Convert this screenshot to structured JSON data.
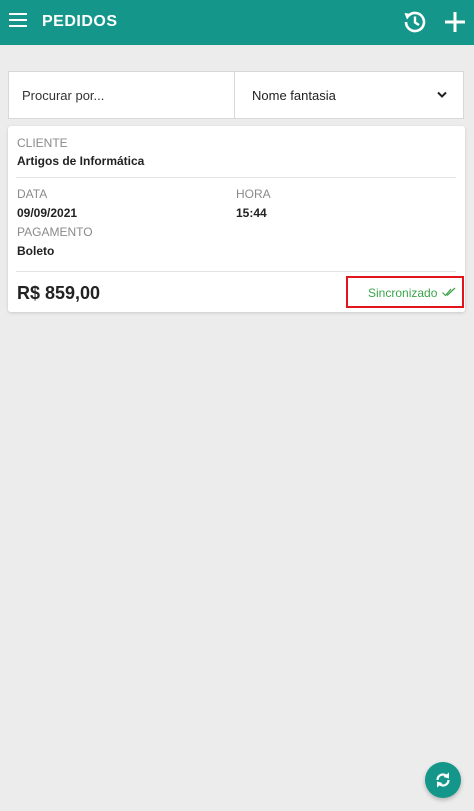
{
  "header": {
    "title": "PEDIDOS"
  },
  "search": {
    "placeholder": "Procurar por...",
    "filter_selected": "Nome fantasia"
  },
  "order": {
    "cliente_label": "CLIENTE",
    "cliente_value": "Artigos de Informática",
    "data_label": "DATA",
    "data_value": "09/09/2021",
    "hora_label": "HORA",
    "hora_value": "15:44",
    "pagamento_label": "PAGAMENTO",
    "pagamento_value": "Boleto",
    "total": "R$ 859,00",
    "status": "Sincronizado"
  },
  "icons": {
    "menu": "menu-icon",
    "history": "history-icon",
    "add": "plus-icon",
    "filter_dropdown": "chevron-down-icon",
    "status": "double-check-icon",
    "sync": "sync-icon"
  },
  "colors": {
    "primary": "#14978a",
    "status_green": "#3aa44a",
    "highlight_red": "#e3141b",
    "background": "#ececec"
  }
}
